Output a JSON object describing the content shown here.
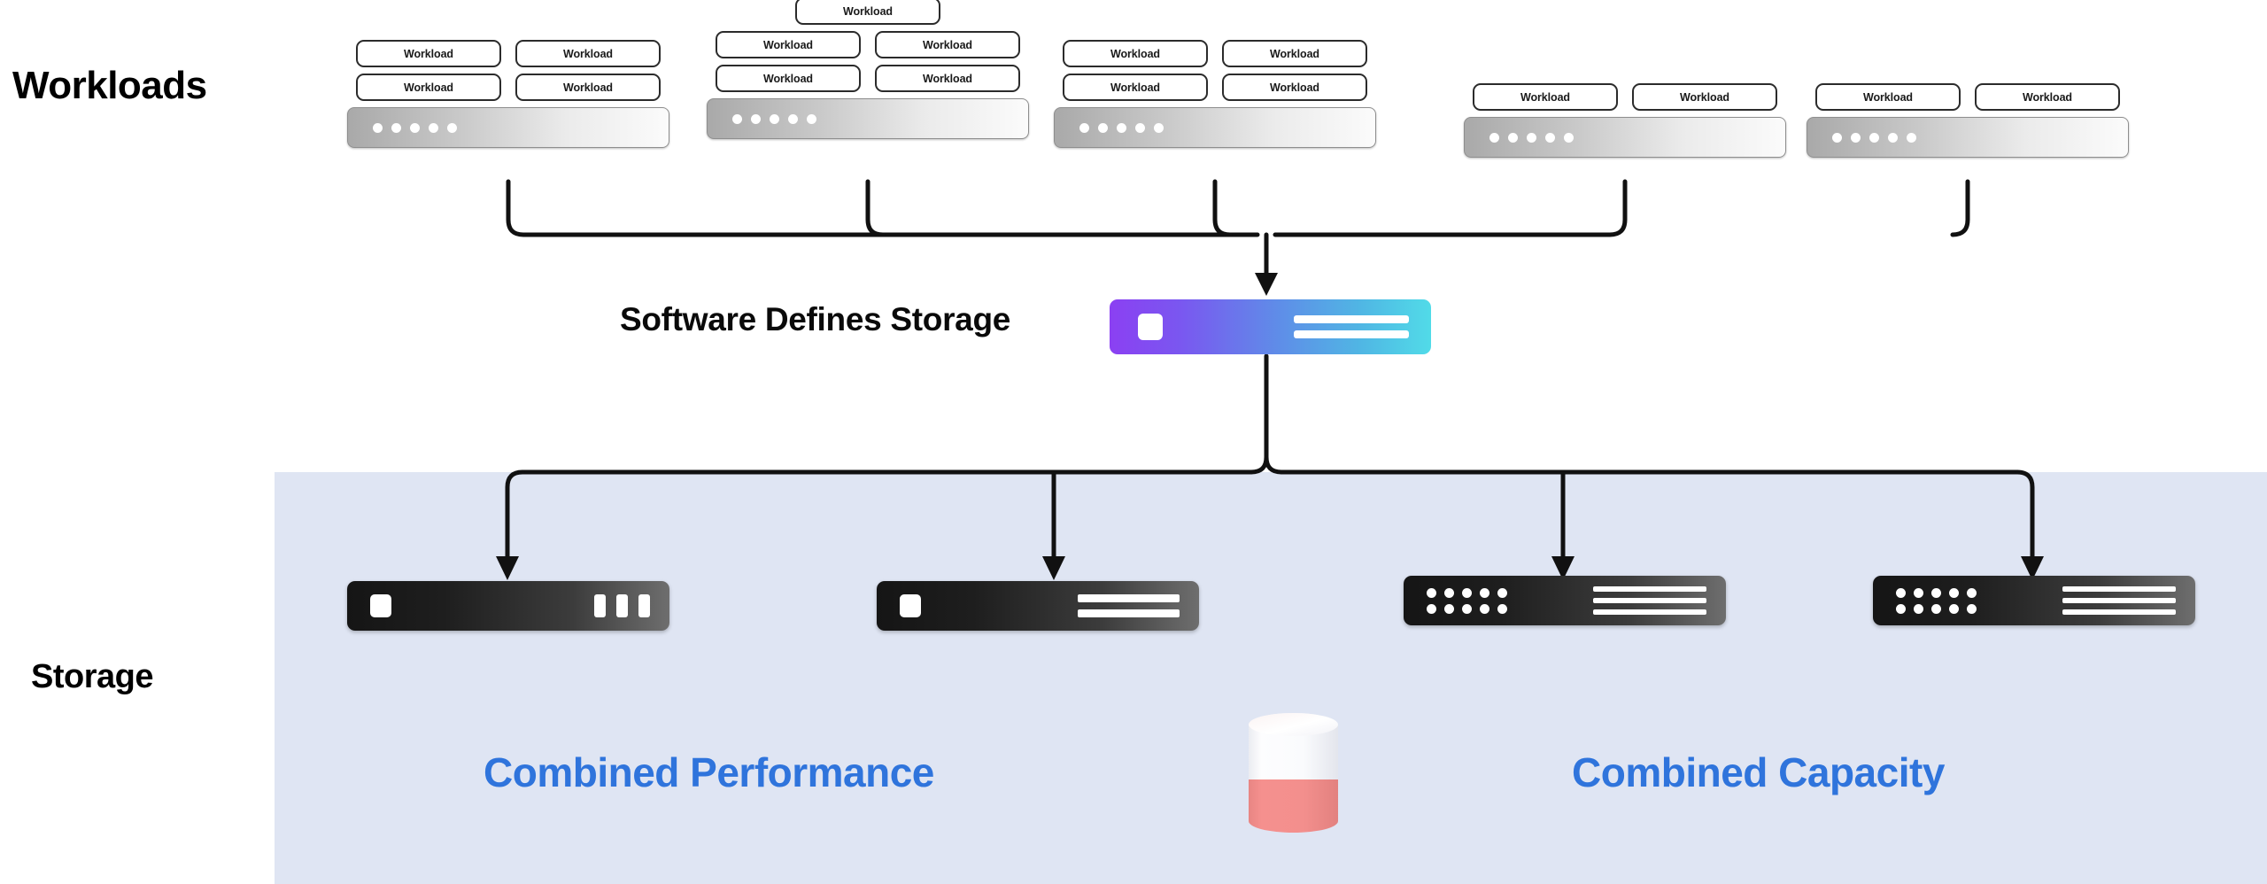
{
  "diagram": {
    "title_workloads": "Workloads",
    "title_storage": "Storage",
    "sds_label": "Software Defines Storage",
    "caption_performance": "Combined Performance",
    "caption_capacity": "Combined Capacity",
    "workload_label": "Workload",
    "colors": {
      "panel_background": "#DFE5F3",
      "caption_blue": "#2F74DC",
      "sds_gradient_start": "#8B40F2",
      "sds_gradient_mid": "#5F8CE8",
      "sds_gradient_end": "#51DBE8",
      "host_gradient_start": "#A9A9A9",
      "host_gradient_end": "#FBFBFB",
      "device_gradient_start": "#151515",
      "device_gradient_end": "#6E6E6E",
      "cylinder_fill": "#F08080",
      "cylinder_empty": "#F0F1F5",
      "outline": "#2B2B2B"
    }
  },
  "clusters": [
    {
      "id": "cluster-1",
      "rows": [
        [
          "Workload",
          "Workload"
        ],
        [
          "Workload",
          "Workload"
        ]
      ],
      "host_dots": 5
    },
    {
      "id": "cluster-2",
      "rows": [
        [
          "Workload"
        ],
        [
          "Workload",
          "Workload"
        ],
        [
          "Workload",
          "Workload"
        ]
      ],
      "host_dots": 5
    },
    {
      "id": "cluster-3",
      "rows": [
        [
          "Workload",
          "Workload"
        ],
        [
          "Workload",
          "Workload"
        ]
      ],
      "host_dots": 5
    },
    {
      "id": "cluster-4",
      "rows": [
        [
          "Workload",
          "Workload"
        ]
      ],
      "host_dots": 5
    },
    {
      "id": "cluster-5",
      "rows": [
        [
          "Workload",
          "Workload"
        ]
      ],
      "host_dots": 5
    }
  ],
  "sds": {
    "icon_left": "square-icon",
    "icon_right": "menu-lines-icon",
    "line_count": 2
  },
  "devices": [
    {
      "id": "device-1",
      "left_icon": "square-icon",
      "right_icon": "vertical-bars-icon",
      "right_count": 3
    },
    {
      "id": "device-2",
      "left_icon": "square-icon",
      "right_icon": "horizontal-bars-icon",
      "right_count": 2
    },
    {
      "id": "device-3",
      "left_icon": "dot-grid-icon",
      "right_icon": "horizontal-bars-icon",
      "right_count": 3
    },
    {
      "id": "device-4",
      "left_icon": "dot-grid-icon",
      "right_icon": "horizontal-bars-icon",
      "right_count": 3
    }
  ]
}
